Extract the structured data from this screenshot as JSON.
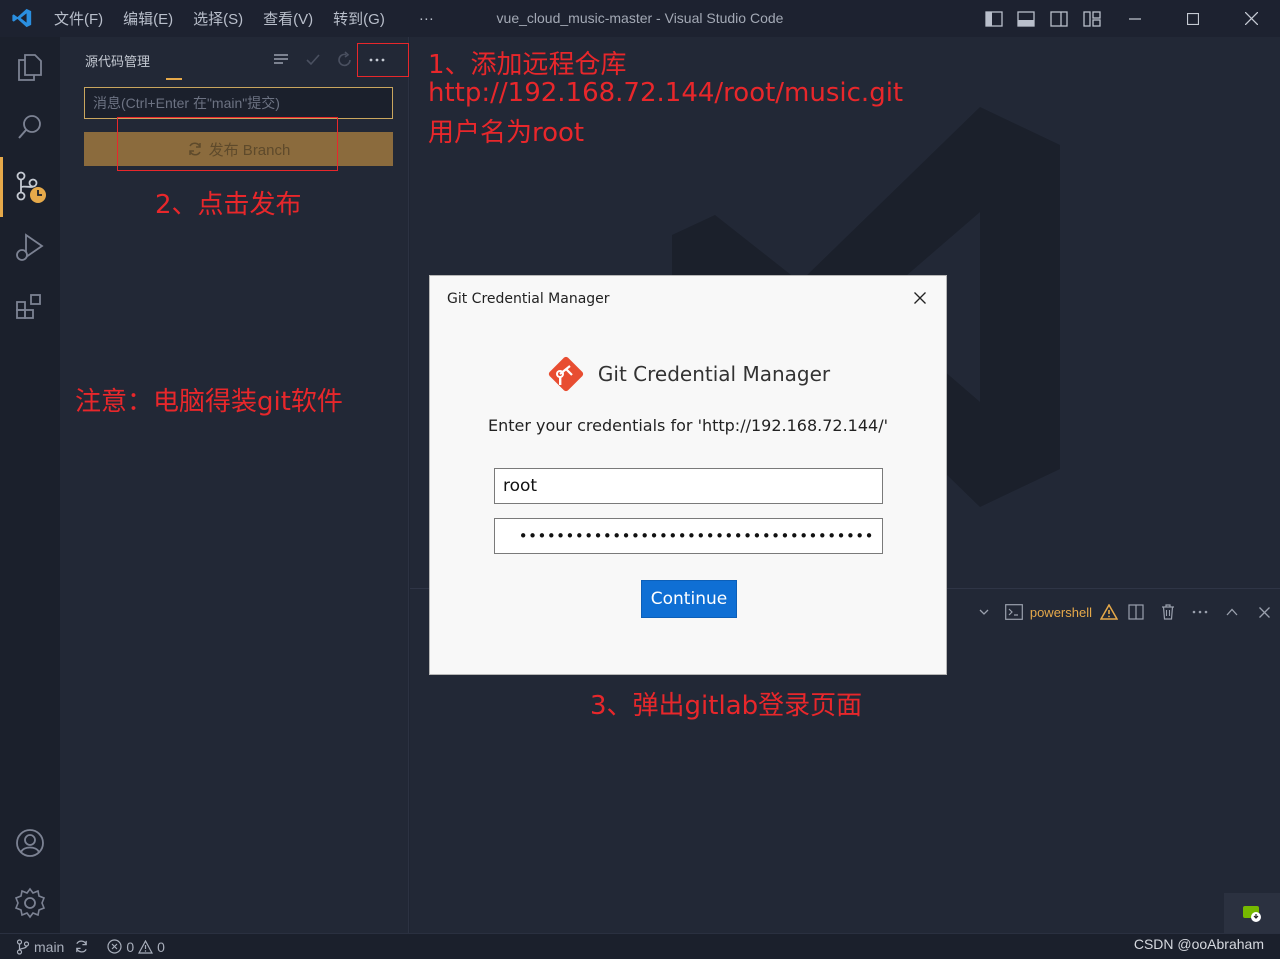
{
  "window": {
    "title": "vue_cloud_music-master - Visual Studio Code",
    "menu": [
      "文件(F)",
      "编辑(E)",
      "选择(S)",
      "查看(V)",
      "转到(G)",
      "···"
    ]
  },
  "activity_bar": {
    "items": [
      "explorer-icon",
      "search-icon",
      "source-control-icon",
      "run-debug-icon",
      "extensions-icon"
    ],
    "bottom": [
      "account-icon",
      "settings-gear-icon"
    ]
  },
  "sidebar": {
    "title": "源代码管理",
    "message_placeholder": "消息(Ctrl+Enter 在\"main\"提交)",
    "publish_label": "发布 Branch"
  },
  "panel": {
    "shell_label": "powershell"
  },
  "statusbar": {
    "branch": "main",
    "errors": "0",
    "warnings": "0",
    "watermark": "CSDN @ooAbraham"
  },
  "dialog": {
    "title": "Git Credential Manager",
    "header": "Git Credential Manager",
    "prompt": "Enter your credentials for 'http://192.168.72.144/'",
    "username": "root",
    "password_mask": "••••••••••••••••••••••••••••••••••••••",
    "continue_label": "Continue"
  },
  "annotations": {
    "step1_line1": "1、添加远程仓库",
    "step1_line2": "http://192.168.72.144/root/music.git",
    "step1_line3": "用户名为root",
    "step2": "2、点击发布",
    "note": "注意：电脑得装git软件",
    "step3": "3、弹出gitlab登录页面"
  },
  "colors": {
    "accent": "#e6a94a",
    "annotation_red": "#e8272b",
    "continue_blue": "#0f6fd4"
  }
}
